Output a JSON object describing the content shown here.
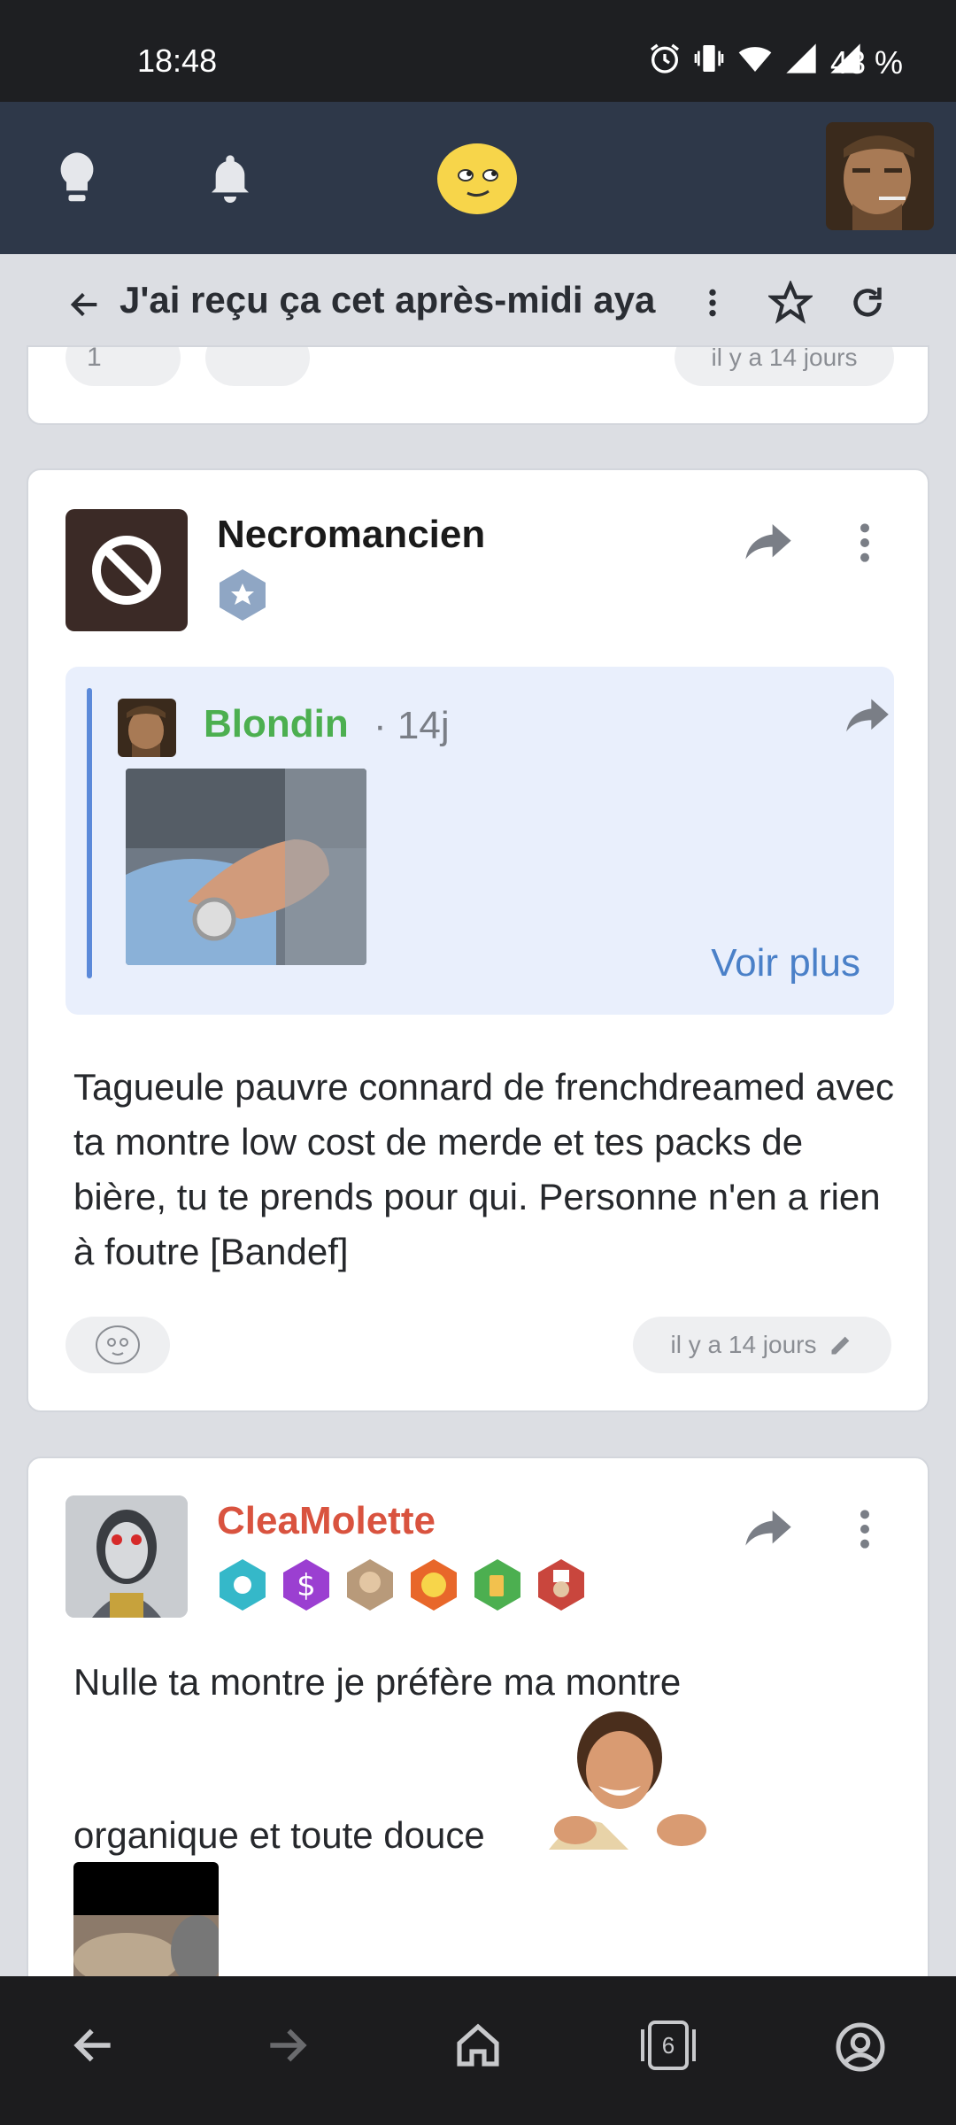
{
  "status_bar": {
    "time": "18:48",
    "battery": "43 %"
  },
  "app_header": {
    "icons": [
      "lightbulb-icon",
      "bell-icon",
      "smiley-logo-icon",
      "user-avatar"
    ]
  },
  "topic": {
    "title": "J'ai reçu ça cet après-midi aya"
  },
  "previous_post": {
    "time": "il y a 14 jours",
    "reaction_count": "1"
  },
  "posts": [
    {
      "author": "Necromancien",
      "author_color": "#1a1a1a",
      "quote": {
        "author": "Blondin",
        "author_color": "#4caf50",
        "time": "· 14j",
        "more_label": "Voir plus"
      },
      "text": "Tagueule pauvre connard de frenchdreamed avec ta montre low cost de merde et tes packs de bière, tu te prends pour qui. Personne n'en a rien à foutre [Bandef]",
      "time": "il y a 14 jours"
    },
    {
      "author": "CleaMolette",
      "author_color": "#d9533f",
      "text_line1": "Nulle ta montre je préfère ma montre",
      "text_line2": "organique et toute douce"
    }
  ],
  "nav_bar": {
    "tabs_count": "6"
  }
}
